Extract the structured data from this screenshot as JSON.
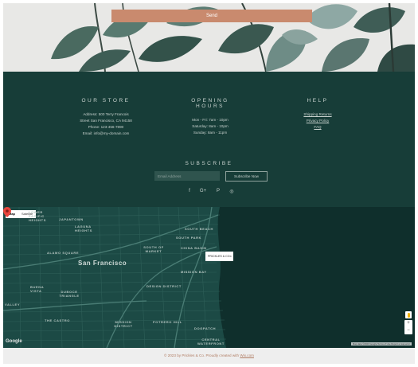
{
  "form": {
    "send_label": "Send"
  },
  "store": {
    "title": "OUR STORE",
    "lines": [
      "Address: 500 Terry Francois",
      "Street San Francisco, CA 94158",
      "Phone: 123-456-7890",
      "Email: info@my-domain.com"
    ]
  },
  "hours": {
    "title": "OPENING HOURS",
    "lines": [
      "Mon - Fri: 7am - 10pm",
      "Saturday: 8am - 10pm",
      "Sunday: 8am - 11pm"
    ]
  },
  "help": {
    "title": "HELP",
    "links": [
      "Shipping Returns",
      "Privacy Policy",
      "FAQ"
    ]
  },
  "subscribe": {
    "title": "SUBSCRIBE",
    "email_placeholder": "Email Address",
    "button_label": "Subscribe Now"
  },
  "social": {
    "facebook": "f",
    "google_plus": "G+",
    "pinterest": "P",
    "instagram": "◎"
  },
  "map": {
    "type_map": "Map",
    "type_satellite": "Satellite",
    "city_label": "San Francisco",
    "neighborhoods": [
      "LOWER PACIFIC HEIGHTS",
      "JAPANTOWN",
      "LAGUNA HEIGHTS",
      "ALAMO SQUARE",
      "SOUTH BEACH",
      "SOUTH PARK",
      "SOUTH OF MARKET",
      "CHINA BASIN",
      "MISSION BAY",
      "DESIGN DISTRICT",
      "DUBOCE TRIANGLE",
      "BUENA VISTA",
      "VALLEY",
      "THE CASTRO",
      "MISSION DISTRICT",
      "POTRERO HILL",
      "DOGPATCH",
      "CENTRAL WATERFRONT"
    ],
    "popup_label": "PRICKLES & CO.",
    "google_label": "Google",
    "terms_text": "Map data ©2023 Google  Terms of Use  Report a map error",
    "zoom_in": "+",
    "zoom_out": "−"
  },
  "footer": {
    "copyright_text": "© 2023 by Prickles & Co. Proudly created with ",
    "wix_link": "Wix.com"
  },
  "colors": {
    "accent": "#c98a6e",
    "footer_bg": "#173d38",
    "map_bg": "#16423e"
  }
}
